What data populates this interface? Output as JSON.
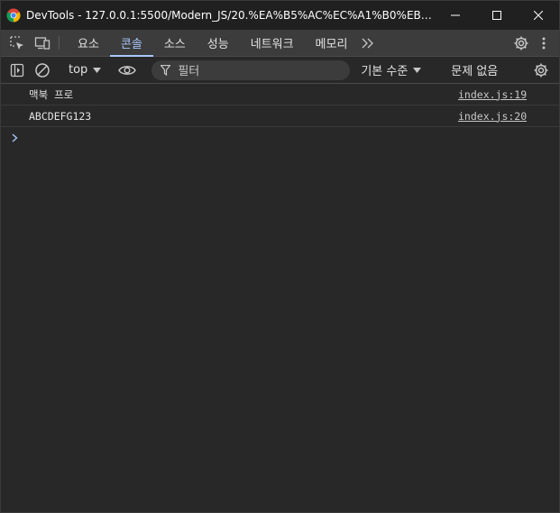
{
  "window": {
    "title": "DevTools - 127.0.0.1:5500/Modern_JS/20.%EA%B5%AC%EC%A1%B0%EB%B6%84..."
  },
  "tabs": [
    {
      "label": "요소",
      "active": false
    },
    {
      "label": "콘솔",
      "active": true
    },
    {
      "label": "소스",
      "active": false
    },
    {
      "label": "성능",
      "active": false
    },
    {
      "label": "네트워크",
      "active": false
    },
    {
      "label": "메모리",
      "active": false
    }
  ],
  "console_toolbar": {
    "context": "top",
    "filter_placeholder": "필터",
    "levels": "기본 수준",
    "issues": "문제 없음"
  },
  "messages": [
    {
      "text": "맥북 프로",
      "source": "index.js:19"
    },
    {
      "text": "ABCDEFG123",
      "source": "index.js:20"
    }
  ],
  "colors": {
    "accent": "#a8c7fa",
    "background": "#282828",
    "titlebar": "#202020",
    "tabbar": "#3c3c3c"
  },
  "icons": {
    "app": "chrome-icon",
    "minimize": "minimize-icon",
    "maximize": "maximize-icon",
    "close": "close-icon",
    "inspect": "inspect-element-icon",
    "device": "device-toolbar-icon",
    "more_tabs": "chevron-double-right-icon",
    "settings": "gear-icon",
    "more": "kebab-menu-icon",
    "sidebar": "sidebar-toggle-icon",
    "clear": "clear-console-icon",
    "eye": "eye-icon",
    "filter": "filter-icon",
    "prompt": "chevron-right-icon"
  }
}
